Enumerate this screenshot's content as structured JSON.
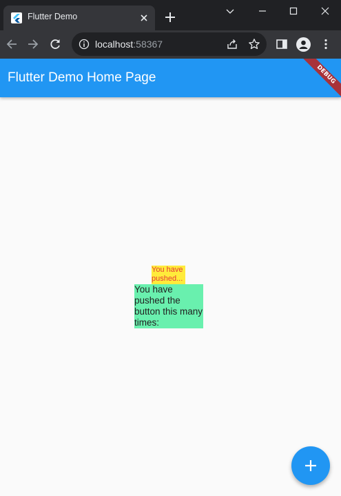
{
  "browser": {
    "tab": {
      "title": "Flutter Demo"
    },
    "address": {
      "host": "localhost",
      "port": ":58367"
    }
  },
  "app": {
    "appbar": {
      "title": "Flutter Demo Home Page"
    },
    "debug_banner": "DEBUG",
    "small_text": "You have pushed...",
    "main_text": "You have pushed the button this many times:",
    "fab_icon": "plus-icon"
  },
  "colors": {
    "appbar": "#2196f3",
    "yellow_box": "#ffeb3b",
    "green_box": "#69f0ae",
    "small_text": "#e53935",
    "debug_banner": "#a8323a"
  }
}
